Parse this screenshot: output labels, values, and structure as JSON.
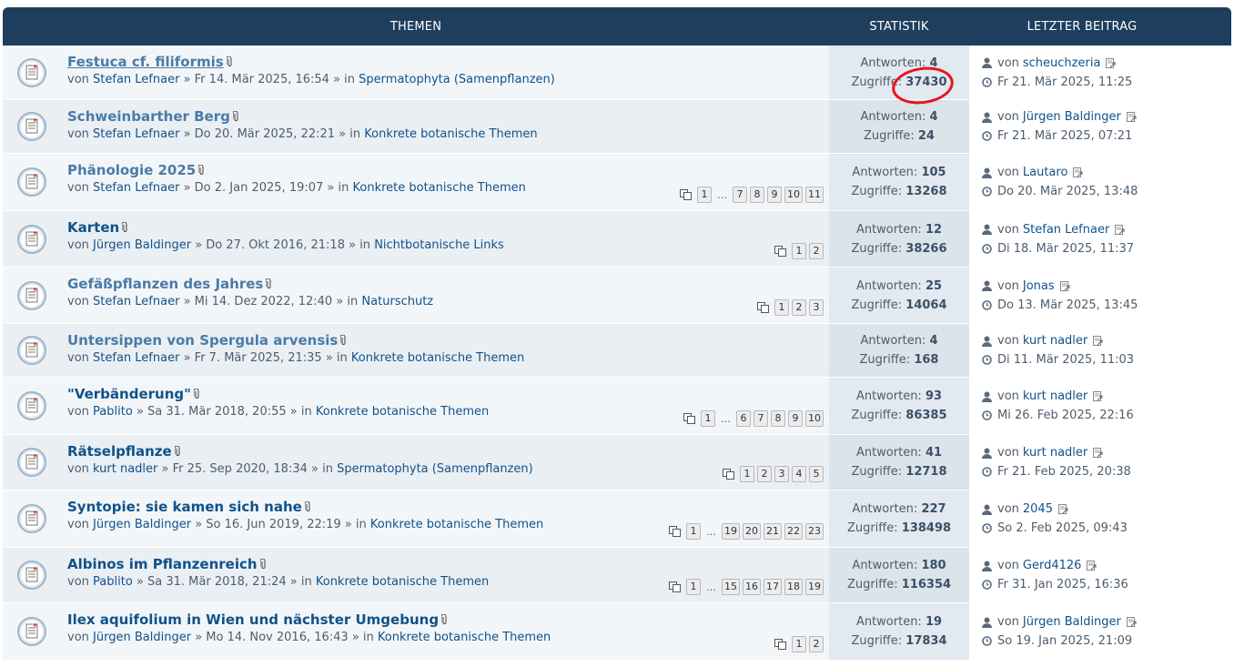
{
  "header": {
    "topics_label": "THEMEN",
    "stats_label": "STATISTIK",
    "last_post_label": "LETZTER BEITRAG"
  },
  "stats_labels": {
    "replies": "Antworten:",
    "views": "Zugriffe:"
  },
  "last_post_by": "von",
  "topics": [
    {
      "title": "Festuca cf. filiformis",
      "meta_prefix": "von",
      "author": "Stefan Lefnaer",
      "date": "» Fr 14. Mär 2025, 16:54 » in",
      "forum": "Spermatophyta (Samenpflanzen)",
      "replies": "4",
      "views": "37430",
      "last_author": "scheuchzeria",
      "last_date": "Fr 21. Mär 2025, 11:25",
      "pages": []
    },
    {
      "title": "Schweinbarther Berg",
      "meta_prefix": "von",
      "author": "Stefan Lefnaer",
      "date": "» Do 20. Mär 2025, 22:21 » in",
      "forum": "Konkrete botanische Themen",
      "replies": "4",
      "views": "24",
      "last_author": "Jürgen Baldinger",
      "last_date": "Fr 21. Mär 2025, 07:21",
      "pages": []
    },
    {
      "title": "Phänologie 2025",
      "meta_prefix": "von",
      "author": "Stefan Lefnaer",
      "date": "» Do 2. Jan 2025, 19:07 » in",
      "forum": "Konkrete botanische Themen",
      "replies": "105",
      "views": "13268",
      "last_author": "Lautaro",
      "last_date": "Do 20. Mär 2025, 13:48",
      "pages": [
        "1",
        "…",
        "7",
        "8",
        "9",
        "10",
        "11"
      ]
    },
    {
      "title": "Karten",
      "meta_prefix": "von",
      "author": "Jürgen Baldinger",
      "date": "» Do 27. Okt 2016, 21:18 » in",
      "forum": "Nichtbotanische Links",
      "replies": "12",
      "views": "38266",
      "last_author": "Stefan Lefnaer",
      "last_date": "Di 18. Mär 2025, 11:37",
      "pages": [
        "1",
        "2"
      ]
    },
    {
      "title": "Gefäßpflanzen des Jahres",
      "meta_prefix": "von",
      "author": "Stefan Lefnaer",
      "date": "» Mi 14. Dez 2022, 12:40 » in",
      "forum": "Naturschutz",
      "replies": "25",
      "views": "14064",
      "last_author": "Jonas",
      "last_date": "Do 13. Mär 2025, 13:45",
      "pages": [
        "1",
        "2",
        "3"
      ]
    },
    {
      "title": "Untersippen von Spergula arvensis",
      "meta_prefix": "von",
      "author": "Stefan Lefnaer",
      "date": "» Fr 7. Mär 2025, 21:35 » in",
      "forum": "Konkrete botanische Themen",
      "replies": "4",
      "views": "168",
      "last_author": "kurt nadler",
      "last_date": "Di 11. Mär 2025, 11:03",
      "pages": []
    },
    {
      "title": "\"Verbänderung\"",
      "meta_prefix": "von",
      "author": "Pablito",
      "date": "» Sa 31. Mär 2018, 20:55 » in",
      "forum": "Konkrete botanische Themen",
      "replies": "93",
      "views": "86385",
      "last_author": "kurt nadler",
      "last_date": "Mi 26. Feb 2025, 22:16",
      "pages": [
        "1",
        "…",
        "6",
        "7",
        "8",
        "9",
        "10"
      ]
    },
    {
      "title": "Rätselpflanze",
      "meta_prefix": "von",
      "author": "kurt nadler",
      "date": "» Fr 25. Sep 2020, 18:34 » in",
      "forum": "Spermatophyta (Samenpflanzen)",
      "replies": "41",
      "views": "12718",
      "last_author": "kurt nadler",
      "last_date": "Fr 21. Feb 2025, 20:38",
      "pages": [
        "1",
        "2",
        "3",
        "4",
        "5"
      ]
    },
    {
      "title": "Syntopie: sie kamen sich nahe",
      "meta_prefix": "von",
      "author": "Jürgen Baldinger",
      "date": "» So 16. Jun 2019, 22:19 » in",
      "forum": "Konkrete botanische Themen",
      "replies": "227",
      "views": "138498",
      "last_author": "2045",
      "last_date": "So 2. Feb 2025, 09:43",
      "pages": [
        "1",
        "…",
        "19",
        "20",
        "21",
        "22",
        "23"
      ]
    },
    {
      "title": "Albinos im Pflanzenreich",
      "meta_prefix": "von",
      "author": "Pablito",
      "date": "» Sa 31. Mär 2018, 21:24 » in",
      "forum": "Konkrete botanische Themen",
      "replies": "180",
      "views": "116354",
      "last_author": "Gerd4126",
      "last_date": "Fr 31. Jan 2025, 16:36",
      "pages": [
        "1",
        "…",
        "15",
        "16",
        "17",
        "18",
        "19"
      ]
    },
    {
      "title": "Ilex aquifolium in Wien und nächster Umgebung",
      "meta_prefix": "von",
      "author": "Jürgen Baldinger",
      "date": "» Mo 14. Nov 2016, 16:43 » in",
      "forum": "Konkrete botanische Themen",
      "replies": "19",
      "views": "17834",
      "last_author": "Jürgen Baldinger",
      "last_date": "So 19. Jan 2025, 21:09",
      "pages": [
        "1",
        "2"
      ]
    }
  ],
  "colors": {
    "header_bg": "#1f3e5e",
    "link": "#105289",
    "annotation": "#e8151b"
  }
}
